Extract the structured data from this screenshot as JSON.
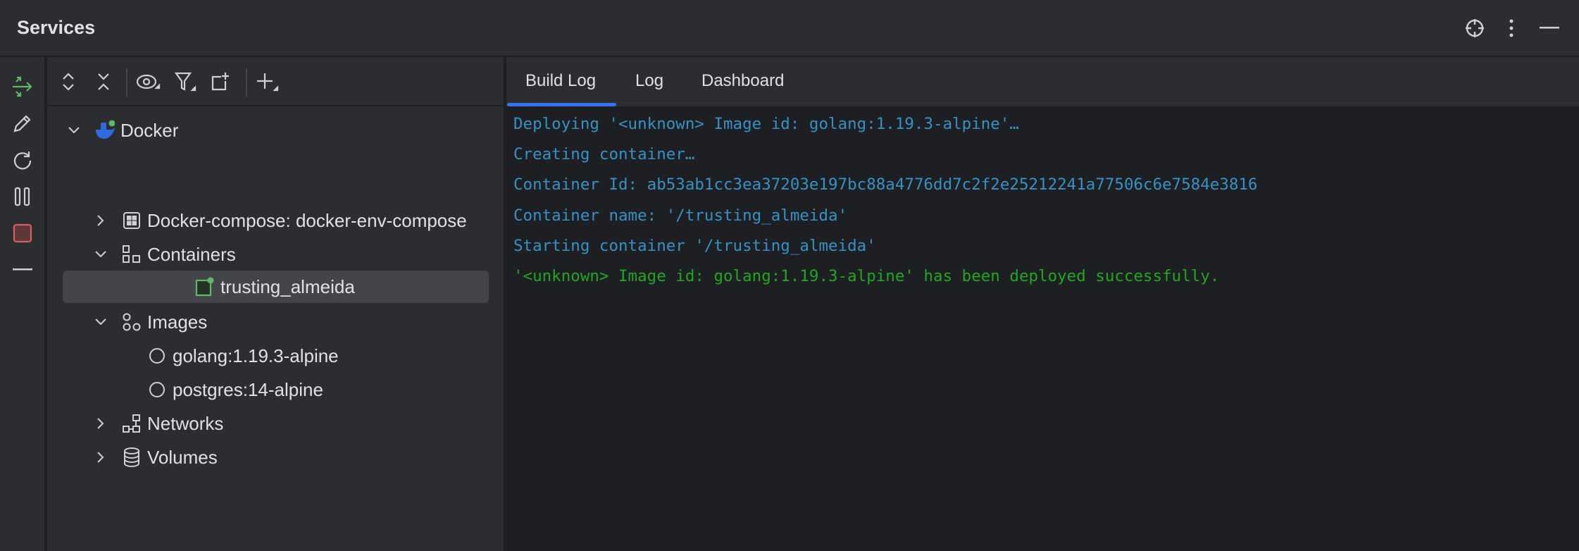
{
  "header": {
    "title": "Services"
  },
  "tree": [
    {
      "label": "Docker",
      "level": 0,
      "expanded": true,
      "icon": "docker-icon"
    },
    {
      "label": "Docker-compose: docker-env-compose",
      "level": 1,
      "expanded": false,
      "icon": "compose-icon"
    },
    {
      "label": "Containers",
      "level": 1,
      "expanded": true,
      "icon": "containers-icon"
    },
    {
      "label": "trusting_almeida",
      "level": 2,
      "icon": "container-running-icon",
      "selected": true
    },
    {
      "label": "Images",
      "level": 1,
      "expanded": true,
      "icon": "images-icon"
    },
    {
      "label": "golang:1.19.3-alpine",
      "level": 2,
      "icon": "image-icon"
    },
    {
      "label": "postgres:14-alpine",
      "level": 2,
      "icon": "image-icon"
    },
    {
      "label": "Networks",
      "level": 1,
      "expanded": false,
      "icon": "networks-icon"
    },
    {
      "label": "Volumes",
      "level": 1,
      "expanded": false,
      "icon": "volumes-icon"
    }
  ],
  "tabs": [
    {
      "label": "Build Log",
      "active": true
    },
    {
      "label": "Log"
    },
    {
      "label": "Dashboard"
    }
  ],
  "log": [
    {
      "text": "Deploying '<unknown> Image id: golang:1.19.3-alpine'…",
      "status": "info"
    },
    {
      "text": "Creating container…",
      "status": "info"
    },
    {
      "text": "Container Id: ab53ab1cc3ea37203e197bc88a4776dd7c2f2e25212241a77506c6e7584e3816",
      "status": "info"
    },
    {
      "text": "Container name: '/trusting_almeida'",
      "status": "info"
    },
    {
      "text": "Starting container '/trusting_almeida'",
      "status": "info"
    },
    {
      "text": "'<unknown> Image id: golang:1.19.3-alpine' has been deployed successfully.",
      "status": "success"
    }
  ],
  "colors": {
    "accent": "#3574f0",
    "info": "#3592c4",
    "success": "#1ea81e"
  }
}
